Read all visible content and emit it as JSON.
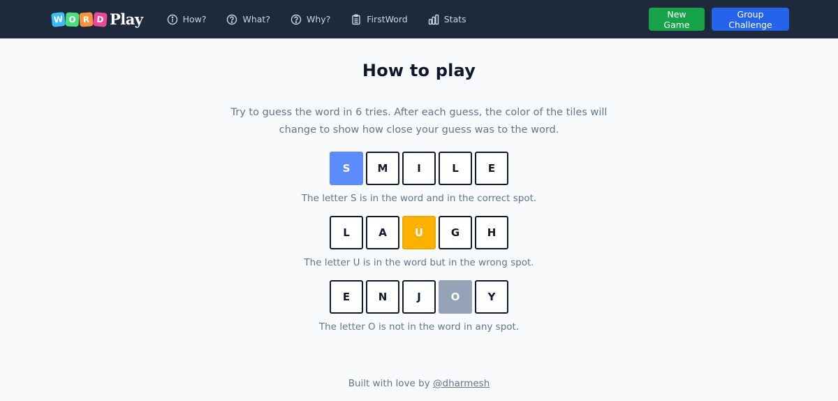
{
  "nav": {
    "logo": {
      "tiles": [
        {
          "letter": "W",
          "color": "#38bdf8"
        },
        {
          "letter": "O",
          "color": "#4ade80"
        },
        {
          "letter": "R",
          "color": "#fb923c"
        },
        {
          "letter": "D",
          "color": "#ec4899"
        }
      ],
      "text": "Play"
    },
    "links": [
      {
        "label": "How?",
        "icon": "info-circle-icon"
      },
      {
        "label": "What?",
        "icon": "question-circle-icon"
      },
      {
        "label": "Why?",
        "icon": "question-circle-icon"
      },
      {
        "label": "FirstWord",
        "icon": "clipboard-icon"
      },
      {
        "label": "Stats",
        "icon": "bar-chart-icon"
      }
    ],
    "buttons": {
      "new_game": "New Game",
      "group_challenge": "Group Challenge"
    }
  },
  "main": {
    "title": "How to play",
    "intro": "Try to guess the word in 6 tries. After each guess, the color of the tiles will change to show how close your guess was to the word.",
    "examples": [
      {
        "tiles": [
          {
            "letter": "S",
            "state": "correct"
          },
          {
            "letter": "M",
            "state": "empty"
          },
          {
            "letter": "I",
            "state": "empty"
          },
          {
            "letter": "L",
            "state": "empty"
          },
          {
            "letter": "E",
            "state": "empty"
          }
        ],
        "caption": "The letter S is in the word and in the correct spot."
      },
      {
        "tiles": [
          {
            "letter": "L",
            "state": "empty"
          },
          {
            "letter": "A",
            "state": "empty"
          },
          {
            "letter": "U",
            "state": "present"
          },
          {
            "letter": "G",
            "state": "empty"
          },
          {
            "letter": "H",
            "state": "empty"
          }
        ],
        "caption": "The letter U is in the word but in the wrong spot."
      },
      {
        "tiles": [
          {
            "letter": "E",
            "state": "empty"
          },
          {
            "letter": "N",
            "state": "empty"
          },
          {
            "letter": "J",
            "state": "empty"
          },
          {
            "letter": "O",
            "state": "absent"
          },
          {
            "letter": "Y",
            "state": "empty"
          }
        ],
        "caption": "The letter O is not in the word in any spot."
      }
    ]
  },
  "colors": {
    "correct": "#5b8cf9",
    "present": "#fbb002",
    "absent": "#94a3b8",
    "nav_bg": "#1e293b",
    "new_game_bg": "#16a34a",
    "group_challenge_bg": "#2563eb"
  },
  "footer": {
    "text": "Built with love by ",
    "link": "@dharmesh"
  }
}
